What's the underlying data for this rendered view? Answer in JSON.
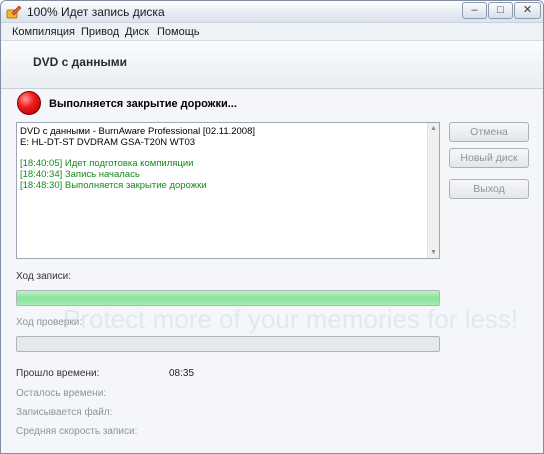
{
  "window": {
    "title": "100% Идет запись диска",
    "controls": {
      "minimize": "–",
      "maximize": "□",
      "close": "✕"
    }
  },
  "menu": [
    "Компиляция",
    "Привод",
    "Диск",
    "Помощь"
  ],
  "header": {
    "title": "DVD с данными"
  },
  "status": {
    "text": "Выполняется закрытие дорожки...",
    "icon": "red-status-orb-icon"
  },
  "log": {
    "lines": [
      {
        "text": "DVD с данными - BurnAware Professional [02.11.2008]",
        "color": "black"
      },
      {
        "text": "E: HL-DT-ST DVDRAM GSA-T20N WT03",
        "color": "black"
      },
      {
        "text": "",
        "color": "gap"
      },
      {
        "text": "[18:40:05] Идет подготовка компиляции",
        "color": "green"
      },
      {
        "text": "[18:40:34] Запись началась",
        "color": "green"
      },
      {
        "text": "[18:48:30] Выполняется закрытие дорожки",
        "color": "green"
      }
    ]
  },
  "buttons": {
    "cancel": "Отмена",
    "new_disc": "Новый диск",
    "exit": "Выход"
  },
  "progress": {
    "write_label": "Ход записи:",
    "write_fraction": 1.0,
    "verify_label": "Ход проверки:",
    "verify_fraction": 0.0
  },
  "info": {
    "elapsed_label": "Прошло времени:",
    "elapsed_value": "08:35",
    "remaining_label": "Осталось времени:",
    "file_label": "Записывается файл:",
    "speed_label": "Средняя скорость записи:"
  },
  "watermark": "Protect more of your memories for less!",
  "colors": {
    "log_green": "#138a1d",
    "progress_green": "#8be39b",
    "status_red": "#f21c1c"
  }
}
